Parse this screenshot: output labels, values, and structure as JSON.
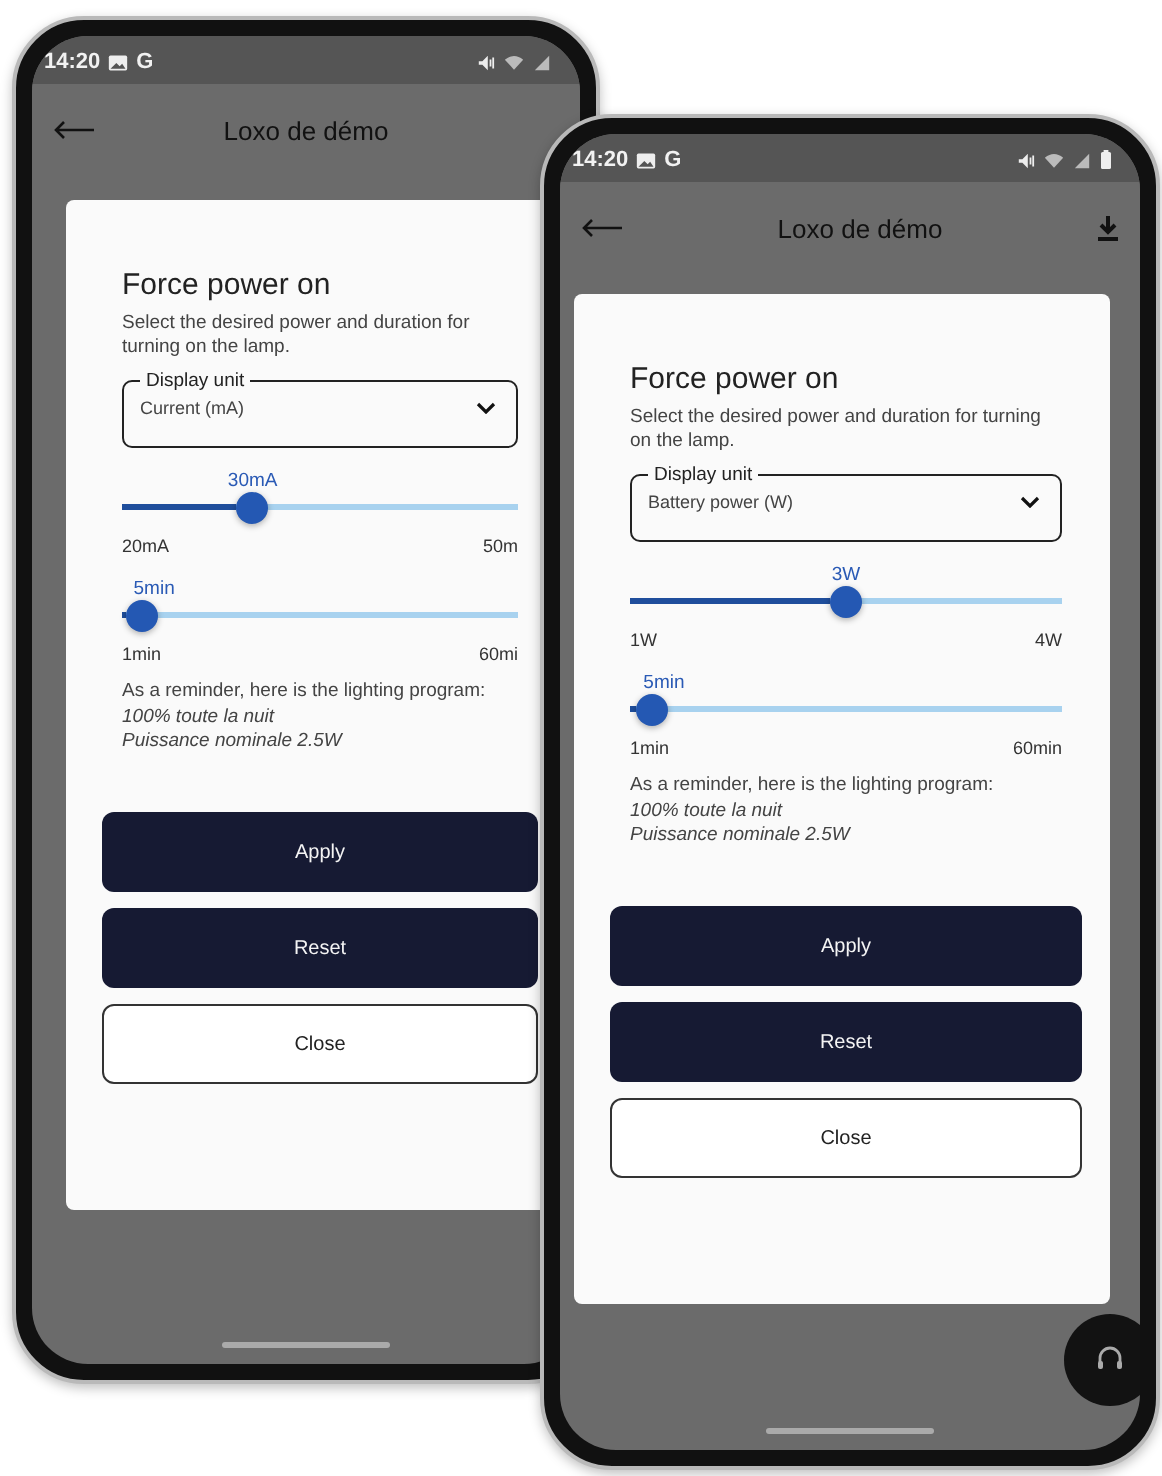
{
  "phones": [
    {
      "status_bar": {
        "time": "14:20",
        "network": "G",
        "battery_icon": false
      },
      "header": {
        "title": "Loxo de démo",
        "download_button": false
      },
      "dialog": {
        "title": "Force power on",
        "description": "Select the desired power and duration for turning on the lamp.",
        "select": {
          "label": "Display unit",
          "value": "Current (mA)"
        },
        "sliders": [
          {
            "value_label": "30mA",
            "level": 0.33,
            "min_label": "20mA",
            "max_label": "50m"
          },
          {
            "value_label": "5min",
            "level": 0.05,
            "min_label": "1min",
            "max_label": "60mi"
          }
        ],
        "reminder": {
          "intro": "As a reminder, here is the lighting program:",
          "lines": [
            "100% toute la nuit",
            "Puissance nominale 2.5W"
          ]
        },
        "buttons": [
          {
            "label": "Apply",
            "kind": "primary"
          },
          {
            "label": "Reset",
            "kind": "primary"
          },
          {
            "label": "Close",
            "kind": "outline"
          }
        ]
      },
      "support_button": false
    },
    {
      "status_bar": {
        "time": "14:20",
        "network": "G",
        "battery_icon": true
      },
      "header": {
        "title": "Loxo de démo",
        "download_button": true
      },
      "dialog": {
        "title": "Force power on",
        "description": "Select the desired power and duration for turning on the lamp.",
        "select": {
          "label": "Display unit",
          "value": "Battery power (W)"
        },
        "sliders": [
          {
            "value_label": "3W",
            "level": 0.5,
            "min_label": "1W",
            "max_label": "4W"
          },
          {
            "value_label": "5min",
            "level": 0.05,
            "min_label": "1min",
            "max_label": "60min"
          }
        ],
        "reminder": {
          "intro": "As a reminder, here is the lighting program:",
          "lines": [
            "100% toute la nuit",
            "Puissance nominale 2.5W"
          ]
        },
        "buttons": [
          {
            "label": "Apply",
            "kind": "primary"
          },
          {
            "label": "Reset",
            "kind": "primary"
          },
          {
            "label": "Close",
            "kind": "outline"
          }
        ]
      },
      "support_button": true
    }
  ]
}
